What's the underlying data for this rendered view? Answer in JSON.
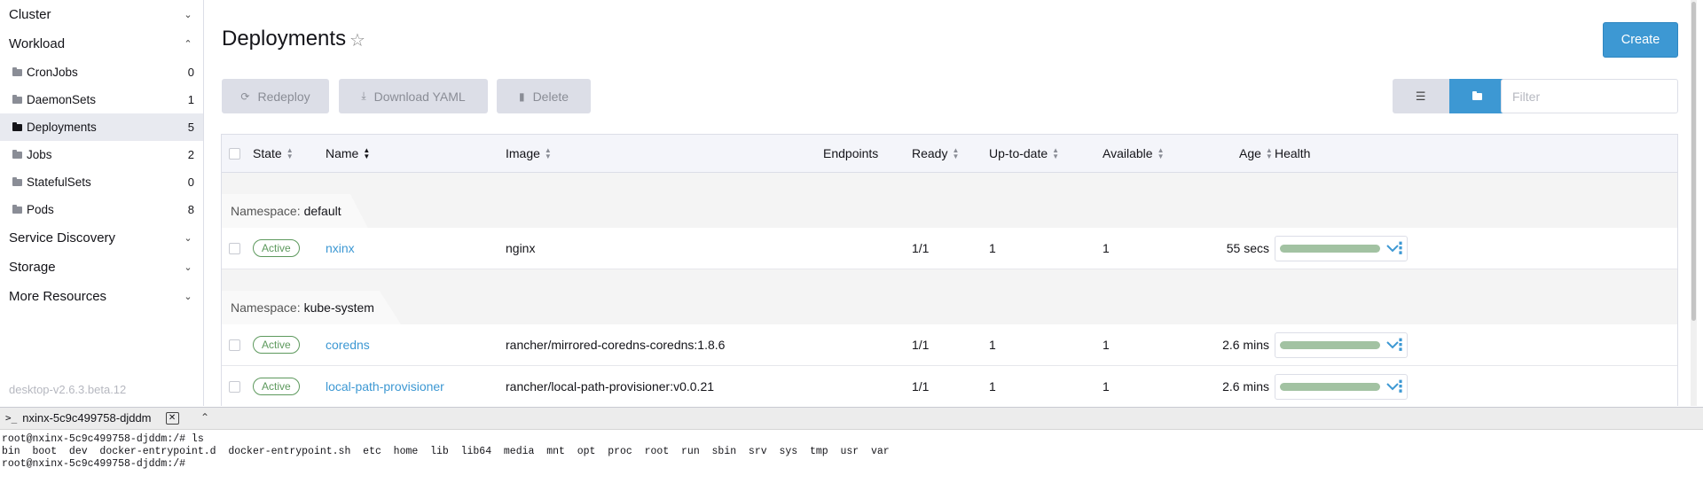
{
  "sidebar": {
    "groups": [
      {
        "label": "Cluster",
        "expanded": false
      },
      {
        "label": "Workload",
        "expanded": true
      },
      {
        "label": "Service Discovery",
        "expanded": false
      },
      {
        "label": "Storage",
        "expanded": false
      },
      {
        "label": "More Resources",
        "expanded": false
      }
    ],
    "workload_items": [
      {
        "label": "CronJobs",
        "count": "0"
      },
      {
        "label": "DaemonSets",
        "count": "1"
      },
      {
        "label": "Deployments",
        "count": "5",
        "active": true
      },
      {
        "label": "Jobs",
        "count": "2"
      },
      {
        "label": "StatefulSets",
        "count": "0"
      },
      {
        "label": "Pods",
        "count": "8"
      }
    ],
    "version": "desktop-v2.6.3.beta.12"
  },
  "header": {
    "title": "Deployments",
    "create_label": "Create"
  },
  "actions": {
    "redeploy": "Redeploy",
    "download_yaml": "Download YAML",
    "delete": "Delete"
  },
  "filter": {
    "placeholder": "Filter"
  },
  "table": {
    "columns": {
      "state": "State",
      "name": "Name",
      "image": "Image",
      "endpoints": "Endpoints",
      "ready": "Ready",
      "uptodate": "Up-to-date",
      "available": "Available",
      "age": "Age",
      "health": "Health"
    },
    "namespace_prefix": "Namespace:",
    "groups": [
      {
        "namespace": "default",
        "rows": [
          {
            "state": "Active",
            "name": "nxinx",
            "image": "nginx",
            "endpoints": "",
            "ready": "1/1",
            "uptodate": "1",
            "available": "1",
            "age": "55 secs"
          }
        ]
      },
      {
        "namespace": "kube-system",
        "rows": [
          {
            "state": "Active",
            "name": "coredns",
            "image": "rancher/mirrored-coredns-coredns:1.8.6",
            "endpoints": "",
            "ready": "1/1",
            "uptodate": "1",
            "available": "1",
            "age": "2.6 mins"
          },
          {
            "state": "Active",
            "name": "local-path-provisioner",
            "image": "rancher/local-path-provisioner:v0.0.21",
            "endpoints": "",
            "ready": "1/1",
            "uptodate": "1",
            "available": "1",
            "age": "2.6 mins"
          }
        ]
      }
    ]
  },
  "terminal": {
    "tab_label": "nxinx-5c9c499758-djddm",
    "lines": [
      "root@nxinx-5c9c499758-djddm:/# ls",
      "bin  boot  dev  docker-entrypoint.d  docker-entrypoint.sh  etc  home  lib  lib64  media  mnt  opt  proc  root  run  sbin  srv  sys  tmp  usr  var",
      "root@nxinx-5c9c499758-djddm:/#"
    ]
  },
  "colors": {
    "accent": "#3d98d3",
    "active_badge": "#5d995d",
    "health_bar": "#a2c2a2"
  }
}
